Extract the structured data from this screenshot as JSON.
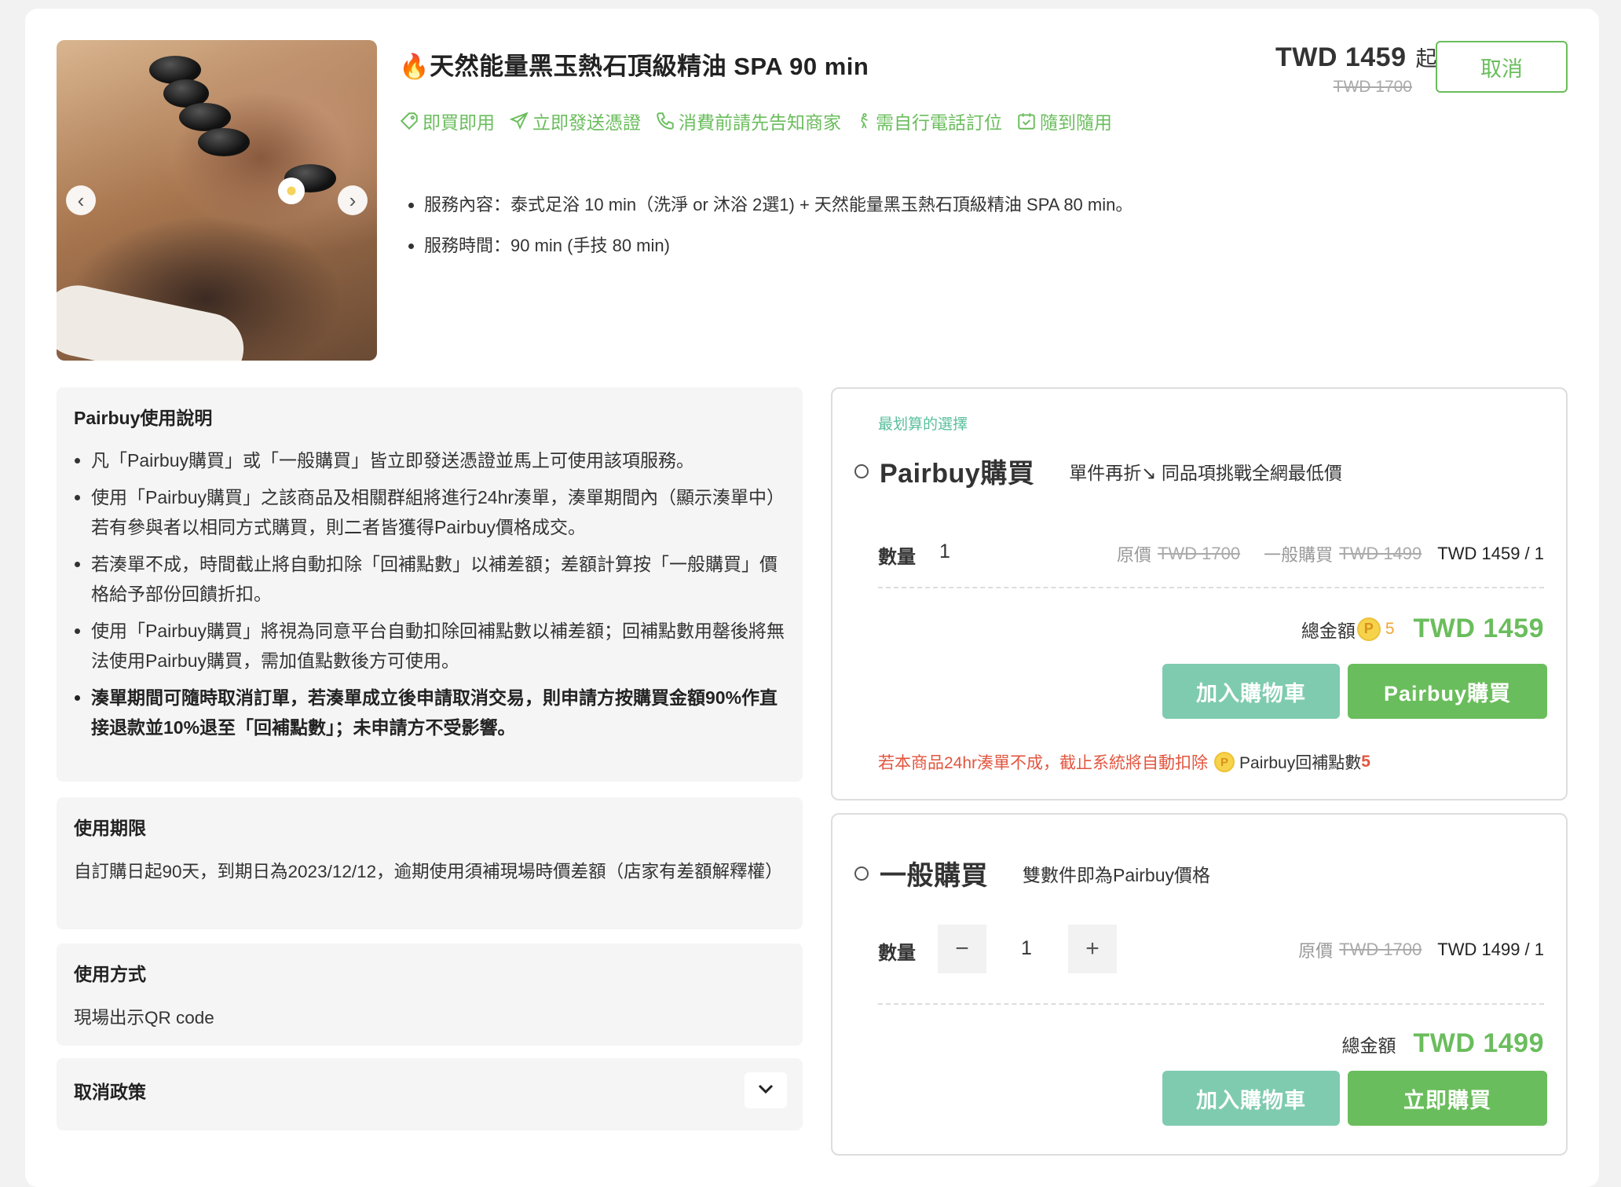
{
  "product": {
    "title": "🔥天然能量黑玉熱石頂級精油 SPA 90 min",
    "price": "TWD 1459",
    "price_suffix": "起",
    "original_price": "TWD 1700",
    "cancel_label": "取消",
    "features": [
      {
        "icon": "ticket-icon",
        "label": "即買即用"
      },
      {
        "icon": "send-icon",
        "label": "立即發送憑證"
      },
      {
        "icon": "phone-icon",
        "label": "消費前請先告知商家"
      },
      {
        "icon": "walk-icon",
        "label": "需自行電話訂位"
      },
      {
        "icon": "calendar-check-icon",
        "label": "隨到隨用"
      }
    ],
    "bullets": [
      "服務內容：泰式足浴 10 min（洗淨 or 沐浴 2選1) + 天然能量黑玉熱石頂級精油 SPA 80 min。",
      "服務時間：90 min (手技 80 min)"
    ],
    "gallery": {
      "prev": "‹",
      "next": "›"
    }
  },
  "usage": {
    "title": "Pairbuy使用說明",
    "items": [
      {
        "text": "凡「Pairbuy購買」或「一般購買」皆立即發送憑證並馬上可使用該項服務。",
        "bold": false
      },
      {
        "text": "使用「Pairbuy購買」之該商品及相關群組將進行24hr湊單，湊單期間內（顯示湊單中）若有參與者以相同方式購買，則二者皆獲得Pairbuy價格成交。",
        "bold": false
      },
      {
        "text": "若湊單不成，時間截止將自動扣除「回補點數」以補差額；差額計算按「一般購買」價格給予部份回饋折扣。",
        "bold": false
      },
      {
        "text": "使用「Pairbuy購買」將視為同意平台自動扣除回補點數以補差額；回補點數用罄後將無法使用Pairbuy購買，需加值點數後方可使用。",
        "bold": false
      },
      {
        "text": "湊單期間可隨時取消訂單，若湊單成立後申請取消交易，則申請方按購買金額90%作直接退款並10%退至「回補點數」；未申請方不受影響。",
        "bold": true
      }
    ]
  },
  "validity": {
    "title": "使用期限",
    "text": "自訂購日起90天，到期日為2023/12/12，逾期使用須補現場時價差額（店家有差額解釋權）"
  },
  "method": {
    "title": "使用方式",
    "text": "現場出示QR code"
  },
  "cancel_policy": {
    "title": "取消政策"
  },
  "pairbuy_option": {
    "tag": "最划算的選擇",
    "name": "Pairbuy購買",
    "desc": "單件再折↘ 同品項挑戰全網最低價",
    "qty_label": "數量",
    "qty": "1",
    "orig_label": "原價",
    "orig_price": "TWD 1700",
    "normal_label": "一般購買",
    "normal_price": "TWD 1499",
    "unit_price": "TWD 1459 / 1",
    "total_label": "總金額",
    "points": "5",
    "total": "TWD 1459",
    "cart_label": "加入購物車",
    "buy_label": "Pairbuy購買",
    "warn_text": "若本商品24hr湊單不成，截止系統將自動扣除",
    "warn_points_label": "Pairbuy回補點數",
    "warn_points": "5"
  },
  "normal_option": {
    "name": "一般購買",
    "desc": "雙數件即為Pairbuy價格",
    "qty_label": "數量",
    "qty": "1",
    "minus": "−",
    "plus": "+",
    "orig_label": "原價",
    "orig_price": "TWD 1700",
    "unit_price": "TWD 1499 / 1",
    "total_label": "總金額",
    "total": "TWD 1499",
    "cart_label": "加入購物車",
    "buy_label": "立即購買"
  },
  "colors": {
    "accent": "#6abd5c",
    "teal": "#7fcbb0",
    "warn": "#e2553f",
    "points": "#f0a633"
  }
}
